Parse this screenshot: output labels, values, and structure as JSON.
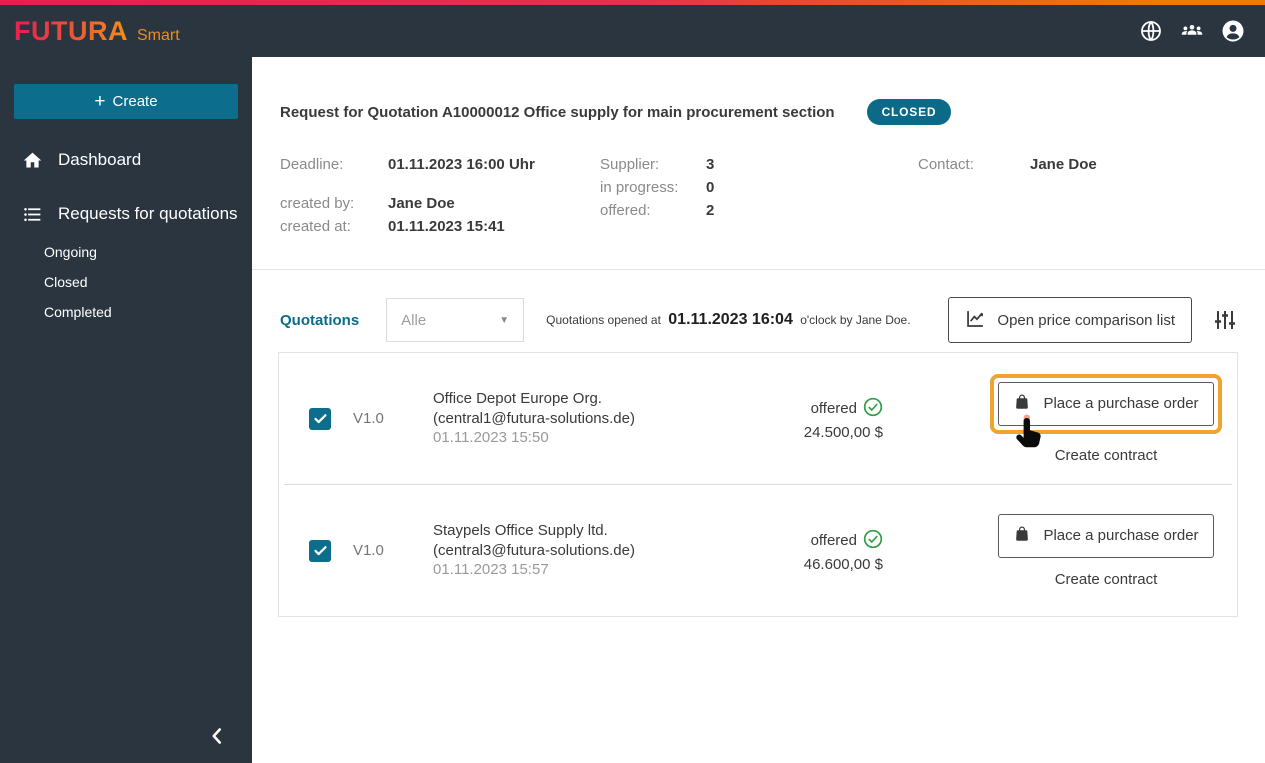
{
  "brand": {
    "name": "FUTURA",
    "suffix": "Smart"
  },
  "topbar": {
    "icons": [
      "globe-icon",
      "users-icon",
      "account-icon"
    ]
  },
  "sidebar": {
    "create": {
      "plus": "+",
      "label": "Create"
    },
    "items": [
      {
        "label": "Dashboard",
        "icon": "home-icon"
      },
      {
        "label": "Requests for quotations",
        "icon": "list-icon",
        "children": [
          "Ongoing",
          "Closed",
          "Completed"
        ]
      }
    ]
  },
  "header": {
    "title": "Request for Quotation A10000012 Office supply for main procurement section",
    "status": "CLOSED"
  },
  "details": {
    "deadline_label": "Deadline:",
    "deadline": "01.11.2023 16:00 Uhr",
    "created_by_label": "created by:",
    "created_by": "Jane Doe",
    "created_at_label": "created at:",
    "created_at": "01.11.2023 15:41",
    "supplier_label": "Supplier:",
    "supplier": "3",
    "in_progress_label": "in progress:",
    "in_progress": "0",
    "offered_label": "offered:",
    "offered": "2",
    "contact_label": "Contact:",
    "contact": "Jane Doe"
  },
  "quotations": {
    "section_label": "Quotations",
    "filter_value": "Alle",
    "opened_prefix": "Quotations opened at",
    "opened_time": "01.11.2023 16:04",
    "opened_suffix": "o'clock by Jane Doe.",
    "compare_button_label": "Open price comparison list",
    "rows": [
      {
        "version": "V1.0",
        "supplier": "Office Depot Europe Org.",
        "email": "(central1@futura-solutions.de)",
        "date": "01.11.2023 15:50",
        "status": "offered",
        "price": "24.500,00 $",
        "order_button": "Place a purchase order",
        "contract_link": "Create contract"
      },
      {
        "version": "V1.0",
        "supplier": "Staypels Office Supply ltd.",
        "email": "(central3@futura-solutions.de)",
        "date": "01.11.2023 15:57",
        "status": "offered",
        "price": "46.600,00 $",
        "order_button": "Place a purchase order",
        "contract_link": "Create contract"
      }
    ]
  },
  "colors": {
    "dark_bar": "#2A3540",
    "accent_teal": "#0D6D8C",
    "badge_teal": "#0A6A87",
    "highlight_orange": "#F0A330",
    "status_green": "#2F9E44",
    "brand_gradient_start": "#E9244E",
    "brand_gradient_end": "#F08A1D"
  }
}
